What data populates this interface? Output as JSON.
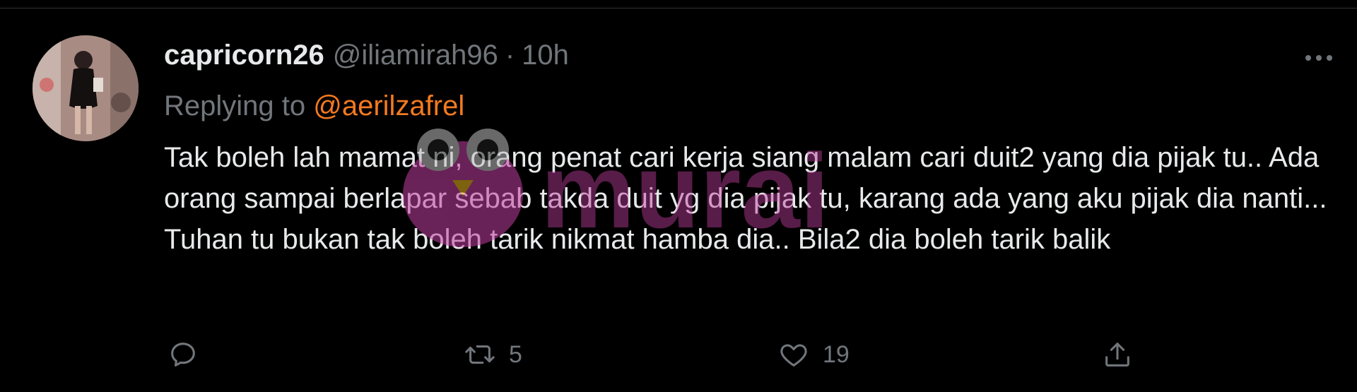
{
  "tweet": {
    "display_name": "capricorn26",
    "handle": "@iliamirah96",
    "separator": "·",
    "time": "10h",
    "replying_prefix": "Replying to",
    "replying_to": "@aerilzafrel",
    "text": "Tak boleh lah mamat ni, orang penat cari kerja siang malam cari duit2 yang dia pijak tu.. Ada orang sampai berlapar sebab takda duit yg dia pijak tu, karang ada yang aku pijak dia nanti... Tuhan tu bukan tak boleh tarik nikmat hamba dia.. Bila2 dia boleh tarik balik",
    "more_icon": "more-horizontal-icon"
  },
  "actions": {
    "reply": {
      "icon": "reply-icon",
      "count": ""
    },
    "retweet": {
      "icon": "retweet-icon",
      "count": "5"
    },
    "like": {
      "icon": "heart-icon",
      "count": "19"
    },
    "share": {
      "icon": "share-icon",
      "count": ""
    }
  },
  "watermark": {
    "text": "murai"
  },
  "colors": {
    "background": "#000000",
    "text_primary": "#e7e9ea",
    "text_secondary": "#71767b",
    "mention": "#f47a20",
    "watermark": "#c03fa0"
  }
}
